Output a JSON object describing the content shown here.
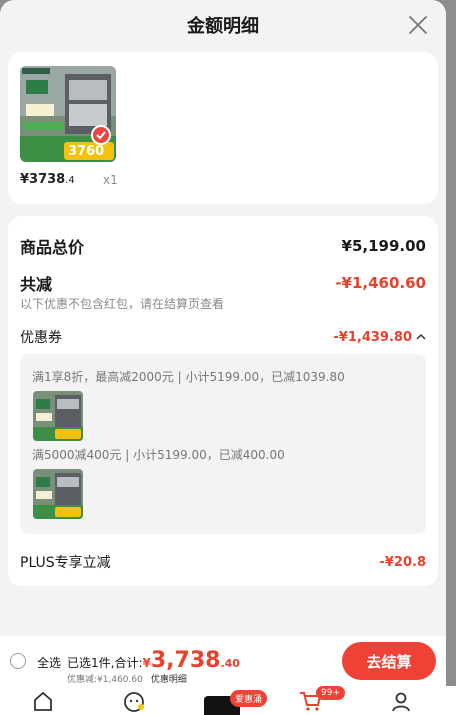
{
  "header": {
    "title": "金额明细"
  },
  "product": {
    "price_int": "¥3738",
    "price_dec": ".4",
    "qty": "x1",
    "image_price": "3760"
  },
  "summary": {
    "goods_total_label": "商品总价",
    "goods_total_value": "¥5,199.00",
    "total_reduce_label": "共减",
    "total_reduce_value": "-¥1,460.60",
    "reduce_note": "以下优惠不包含红包，请在结算页查看",
    "coupon_label": "优惠券",
    "coupon_value": "-¥1,439.80",
    "coupons": [
      {
        "text": "满1享8折，最高减2000元 | 小计5199.00，已减1039.80"
      },
      {
        "text": "满5000减400元 | 小计5199.00，已减400.00"
      }
    ],
    "plus_label": "PLUS专享立减",
    "plus_value": "-¥20.8"
  },
  "bottom": {
    "select_all": "全选",
    "selected_text": "已选1件,合计:",
    "total_symbol": "¥",
    "total_int": "3,738",
    "total_dec": ".40",
    "discount_text": "优惠减:¥1,460.60",
    "detail_link": "优惠明细",
    "checkout": "去结算"
  },
  "tabbar": {
    "aihuiyong": "爱惠涌",
    "cart_badge": "99+"
  },
  "colors": {
    "accent": "#e8412e",
    "button": "#ef4135"
  }
}
